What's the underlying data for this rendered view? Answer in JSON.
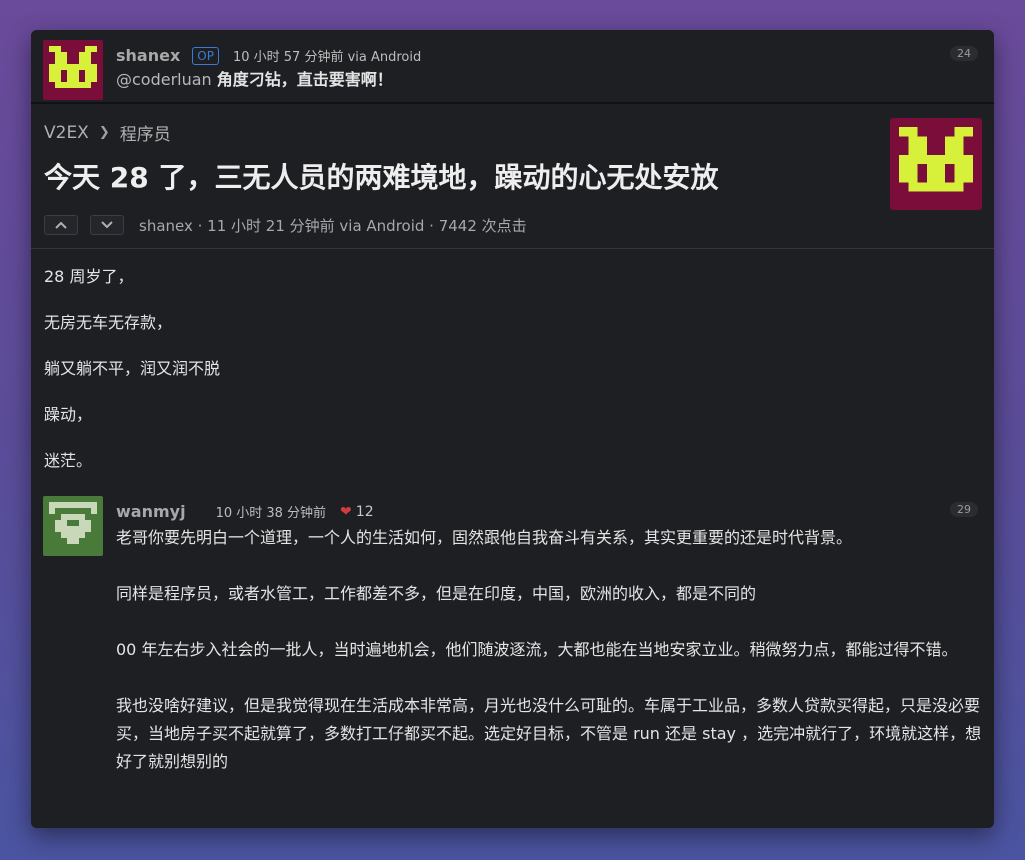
{
  "reply_top": {
    "author": "shanex",
    "op_badge": "OP",
    "time": "10 小时 57 分钟前 via Android",
    "floor": "24",
    "mention": "@coderluan",
    "text": "角度刁钻，直击要害啊！",
    "avatar": "pixel-monster-avatar"
  },
  "topic": {
    "breadcrumb": [
      "V2EX",
      "程序员"
    ],
    "title": "今天 28 了，三无人员的两难境地，躁动的心无处安放",
    "meta": "shanex · 11 小时 21 分钟前 via Android · 7442 次点击",
    "upvote_icon": "chevron-up-icon",
    "downvote_icon": "chevron-down-icon",
    "body": [
      "28 周岁了，",
      "无房无车无存款，",
      "躺又躺不平，润又润不脱",
      "躁动，",
      "迷茫。"
    ]
  },
  "reply_second": {
    "author": "wanmyj",
    "time": "10 小时 38 分钟前",
    "heart_icon": "heart-icon",
    "likes": "12",
    "floor": "29",
    "paragraphs": [
      "老哥你要先明白一个道理，一个人的生活如何，固然跟他自我奋斗有关系，其实更重要的还是时代背景。",
      "同样是程序员，或者水管工，工作都差不多，但是在印度，中国，欧洲的收入，都是不同的",
      "00 年左右步入社会的一批人，当时遍地机会，他们随波逐流，大都也能在当地安家立业。稍微努力点，都能过得不错。",
      "我也没啥好建议，但是我觉得现在生活成本非常高，月光也没什么可耻的。车属于工业品，多数人贷款买得起，只是没必要买，当地房子买不起就算了，多数打工仔都买不起。选定好目标，不管是 run 还是 stay ，选完冲就行了，环境就这样，想好了就别想别的"
    ]
  },
  "colors": {
    "avatar_bg": "#7a0d3a",
    "avatar_fg": "#d7f03a",
    "avatar2_bg": "#4a7a3a",
    "avatar2_fg": "#c8d8b8",
    "op_badge": "#3a7bd5"
  }
}
